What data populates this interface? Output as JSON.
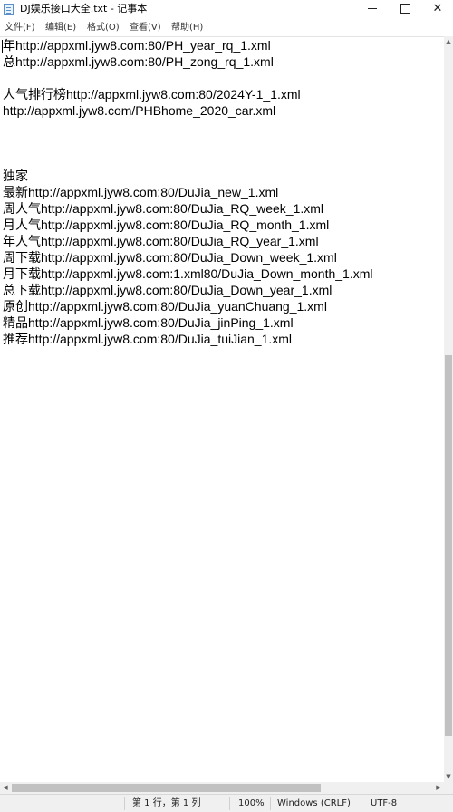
{
  "window": {
    "title": "DJ娱乐接口大全.txt - 记事本",
    "minimize_icon": "minimize-icon",
    "maximize_icon": "maximize-icon",
    "close_label": "✕"
  },
  "menu": {
    "items": [
      {
        "label": "文件(F)"
      },
      {
        "label": "编辑(E)"
      },
      {
        "label": "格式(O)"
      },
      {
        "label": "查看(V)"
      },
      {
        "label": "帮助(H)"
      }
    ]
  },
  "document": {
    "lines": [
      "年http://appxml.jyw8.com:80/PH_year_rq_1.xml",
      "总http://appxml.jyw8.com:80/PH_zong_rq_1.xml",
      "",
      "人气排行榜http://appxml.jyw8.com:80/2024Y-1_1.xml",
      "http://appxml.jyw8.com/PHBhome_2020_car.xml",
      "",
      "",
      "",
      "独家",
      "最新http://appxml.jyw8.com:80/DuJia_new_1.xml",
      "周人气http://appxml.jyw8.com:80/DuJia_RQ_week_1.xml",
      "月人气http://appxml.jyw8.com:80/DuJia_RQ_month_1.xml",
      "年人气http://appxml.jyw8.com:80/DuJia_RQ_year_1.xml",
      "周下载http://appxml.jyw8.com:80/DuJia_Down_week_1.xml",
      "月下载http://appxml.jyw8.com:1.xml80/DuJia_Down_month_1.xml",
      "总下载http://appxml.jyw8.com:80/DuJia_Down_year_1.xml",
      "原创http://appxml.jyw8.com:80/DuJia_yuanChuang_1.xml",
      "精品http://appxml.jyw8.com:80/DuJia_jinPing_1.xml",
      "推荐http://appxml.jyw8.com:80/DuJia_tuiJian_1.xml"
    ]
  },
  "statusbar": {
    "position": "第 1 行，第 1 列",
    "zoom": "100%",
    "line_ending": "Windows (CRLF)",
    "encoding": "UTF-8"
  },
  "scroll": {
    "vertical_arrow_up": "▲",
    "vertical_arrow_down": "▼",
    "horizontal_arrow_left": "◀",
    "horizontal_arrow_right": "▶"
  }
}
